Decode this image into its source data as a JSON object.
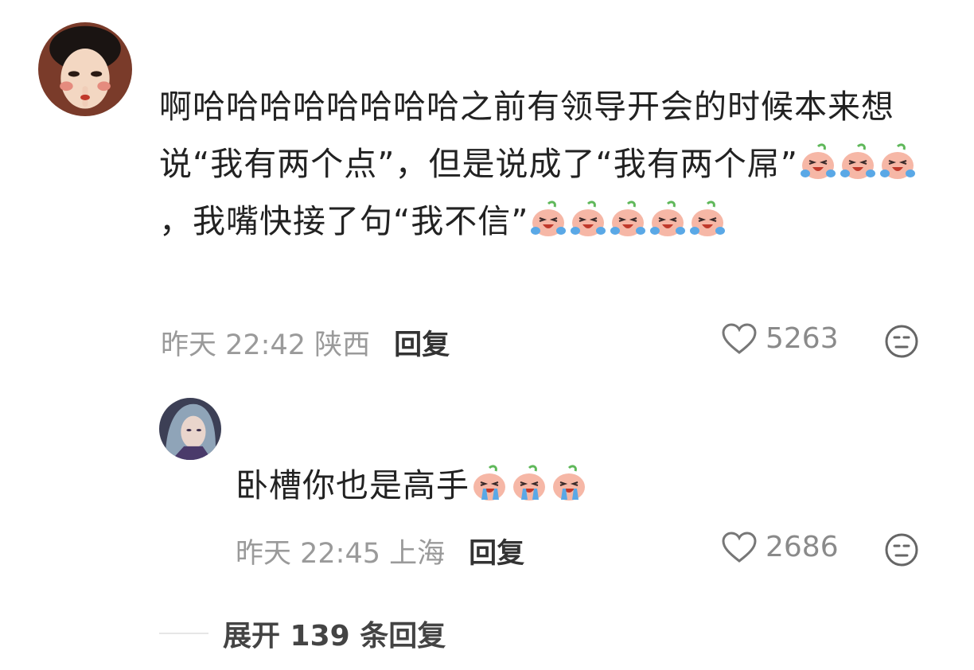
{
  "comment": {
    "segments": [
      {
        "t": "text",
        "v": "啊哈哈哈哈哈哈哈哈之前有领导开会的时候本来想说“我有两个点”，但是说成了“我有两个屌”"
      },
      {
        "t": "emoji",
        "name": "cry-laugh-emoji"
      },
      {
        "t": "emoji",
        "name": "cry-laugh-emoji"
      },
      {
        "t": "emoji",
        "name": "cry-laugh-emoji"
      },
      {
        "t": "text",
        "v": "，我嘴快接了句“我不信”"
      },
      {
        "t": "emoji",
        "name": "cry-laugh-emoji"
      },
      {
        "t": "emoji",
        "name": "cry-laugh-emoji"
      },
      {
        "t": "emoji",
        "name": "cry-laugh-emoji"
      },
      {
        "t": "emoji",
        "name": "cry-laugh-emoji"
      },
      {
        "t": "emoji",
        "name": "cry-laugh-emoji"
      }
    ],
    "time": "昨天 22:42 陕西",
    "reply_label": "回复",
    "likes": "5263"
  },
  "reply": {
    "segments": [
      {
        "t": "text",
        "v": "卧槽你也是高手"
      },
      {
        "t": "emoji",
        "name": "sobbing-emoji"
      },
      {
        "t": "emoji",
        "name": "sobbing-emoji"
      },
      {
        "t": "emoji",
        "name": "sobbing-emoji"
      }
    ],
    "time": "昨天 22:45 上海",
    "reply_label": "回复",
    "likes": "2686"
  },
  "expand_label": "展开 139 条回复",
  "colors": {
    "emoji_face": "#f6b7a6",
    "emoji_tear": "#5aa8e6",
    "emoji_leaf": "#5fb85a",
    "meta": "#9a9a9a"
  }
}
